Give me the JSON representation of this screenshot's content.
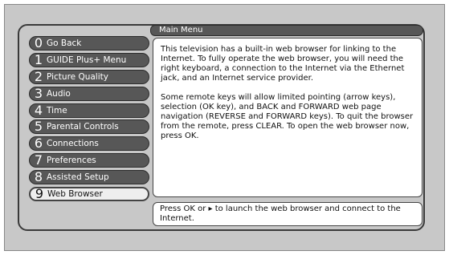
{
  "menu": {
    "items": [
      {
        "number": "0",
        "label": "Go Back"
      },
      {
        "number": "1",
        "label": "GUIDE Plus+ Menu"
      },
      {
        "number": "2",
        "label": "Picture Quality"
      },
      {
        "number": "3",
        "label": "Audio"
      },
      {
        "number": "4",
        "label": "Time"
      },
      {
        "number": "5",
        "label": "Parental Controls"
      },
      {
        "number": "6",
        "label": "Connections"
      },
      {
        "number": "7",
        "label": "Preferences"
      },
      {
        "number": "8",
        "label": "Assisted Setup"
      },
      {
        "number": "9",
        "label": "Web Browser"
      }
    ],
    "selected_index": 9
  },
  "panel": {
    "title": "Main Menu",
    "paragraph1": "This television has a built-in web browser for linking to the Internet. To fully operate the web browser, you will need the right keyboard, a connection to the Internet via the Ethernet jack, and an Internet service provider.",
    "paragraph2": "Some remote keys will allow limited pointing (arrow keys), selection (OK key), and BACK and FORWARD web page navigation (REVERSE and FORWARD keys). To quit the browser from the remote, press CLEAR. To open the web browser now, press OK."
  },
  "status": {
    "text": "Press OK or ▸ to launch the web browser and connect to the Internet."
  }
}
